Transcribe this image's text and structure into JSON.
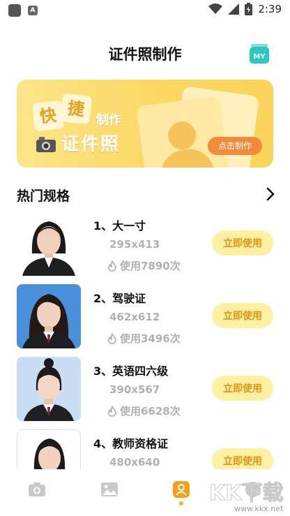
{
  "status_bar": {
    "time": "2:39"
  },
  "header": {
    "title": "证件照制作",
    "my_button_label": "MY"
  },
  "banner": {
    "tile_1": "快",
    "tile_2": "捷",
    "make_text": "制作",
    "main_text": "证件照",
    "button_label": "点击制作"
  },
  "section": {
    "title": "热门规格"
  },
  "specs": [
    {
      "name": "1、大一寸",
      "size": "295x413",
      "usage": "使用7890次",
      "button": "立即使用"
    },
    {
      "name": "2、驾驶证",
      "size": "462x612",
      "usage": "使用3496次",
      "button": "立即使用"
    },
    {
      "name": "3、英语四六级",
      "size": "390x567",
      "usage": "使用6628次",
      "button": "立即使用"
    },
    {
      "name": "4、教师资格证",
      "size": "480x640",
      "usage": "",
      "button": "立即使用"
    }
  ],
  "colors": {
    "accent": "#f6b21a",
    "button_bg": "#fdf0a3",
    "button_text": "#e09412",
    "banner_button": "#f28a3c"
  },
  "watermark": {
    "text": "KK下载",
    "url": "www.kkx.net"
  }
}
